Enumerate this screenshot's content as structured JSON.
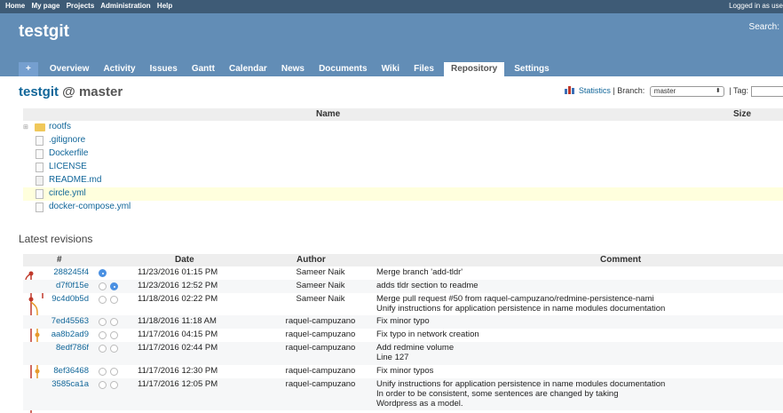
{
  "top_menu": {
    "items": [
      "Home",
      "My page",
      "Projects",
      "Administration",
      "Help"
    ],
    "logged_in_text": "Logged in as use"
  },
  "header": {
    "project_title": "testgit",
    "search_label": "Search:"
  },
  "main_menu": {
    "plus": "+",
    "tabs": [
      "Overview",
      "Activity",
      "Issues",
      "Gantt",
      "Calendar",
      "News",
      "Documents",
      "Wiki",
      "Files",
      "Repository",
      "Settings"
    ],
    "selected": "Repository"
  },
  "repo": {
    "project": "testgit",
    "at": "@ master",
    "statistics": "Statistics",
    "branch_label": "| Branch:",
    "branch_value": "master",
    "tag_label": "| Tag:"
  },
  "files": {
    "col_name": "Name",
    "col_size": "Size",
    "rows": [
      {
        "name": "rootfs",
        "type": "folder"
      },
      {
        "name": ".gitignore",
        "type": "file"
      },
      {
        "name": "Dockerfile",
        "type": "file"
      },
      {
        "name": "LICENSE",
        "type": "file"
      },
      {
        "name": "README.md",
        "type": "text-file"
      },
      {
        "name": "circle.yml",
        "type": "file"
      },
      {
        "name": "docker-compose.yml",
        "type": "file"
      }
    ]
  },
  "latest_revisions": {
    "title": "Latest revisions",
    "headers": {
      "id": "#",
      "date": "Date",
      "author": "Author",
      "comment": "Comment"
    },
    "rows": [
      {
        "id": "288245f4",
        "date": "11/23/2016 01:15 PM",
        "author": "Sameer Naik",
        "comment": "Merge branch 'add-tldr'"
      },
      {
        "id": "d7f0f15e",
        "date": "11/23/2016 12:52 PM",
        "author": "Sameer Naik",
        "comment": "adds tldr section to readme"
      },
      {
        "id": "9c4d0b5d",
        "date": "11/18/2016 02:22 PM",
        "author": "Sameer Naik",
        "comment": "Merge pull request #50 from raquel-campuzano/redmine-persistence-nami\nUnify instructions for application persistence in name modules documentation"
      },
      {
        "id": "7ed45563",
        "date": "11/18/2016 11:18 AM",
        "author": "raquel-campuzano",
        "comment": "Fix minor typo"
      },
      {
        "id": "aa8b2ad9",
        "date": "11/17/2016 04:15 PM",
        "author": "raquel-campuzano",
        "comment": "Fix typo in network creation"
      },
      {
        "id": "8edf786f",
        "date": "11/17/2016 02:44 PM",
        "author": "raquel-campuzano",
        "comment": "Add redmine volume\nLine 127"
      },
      {
        "id": "8ef36468",
        "date": "11/17/2016 12:30 PM",
        "author": "raquel-campuzano",
        "comment": "Fix minor typos"
      },
      {
        "id": "3585ca1a",
        "date": "11/17/2016 12:05 PM",
        "author": "raquel-campuzano",
        "comment": "Unify instructions for application persistence in name modules documentation\nIn order to be consistent, some sentences are changed by taking\nWordpress as a model."
      }
    ]
  },
  "colors": {
    "top_bar": "#3e5b76",
    "header": "#628db6",
    "link": "#116699",
    "graph_red": "#c0392b",
    "graph_orange": "#e69a2c",
    "highlight": "#ffffdd"
  }
}
